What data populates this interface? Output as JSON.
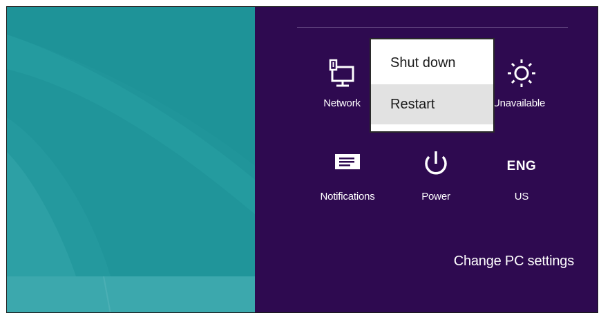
{
  "charm": {
    "tiles": {
      "network": {
        "label": "Network",
        "icon": "network-icon"
      },
      "brightness": {
        "label": "Unavailable",
        "icon": "brightness-icon"
      },
      "notifications": {
        "label": "Notifications",
        "icon": "notifications-icon"
      },
      "power": {
        "label": "Power",
        "icon": "power-icon"
      },
      "language": {
        "code": "ENG",
        "label": "US"
      }
    },
    "change_pc_settings": "Change PC settings"
  },
  "power_menu": {
    "items": [
      {
        "label": "Shut down",
        "highlighted": false
      },
      {
        "label": "Restart",
        "highlighted": true
      }
    ]
  },
  "colors": {
    "charm_background": "#2e0a50",
    "desktop_background": "#20959a",
    "menu_highlight": "#e2e2e2"
  }
}
